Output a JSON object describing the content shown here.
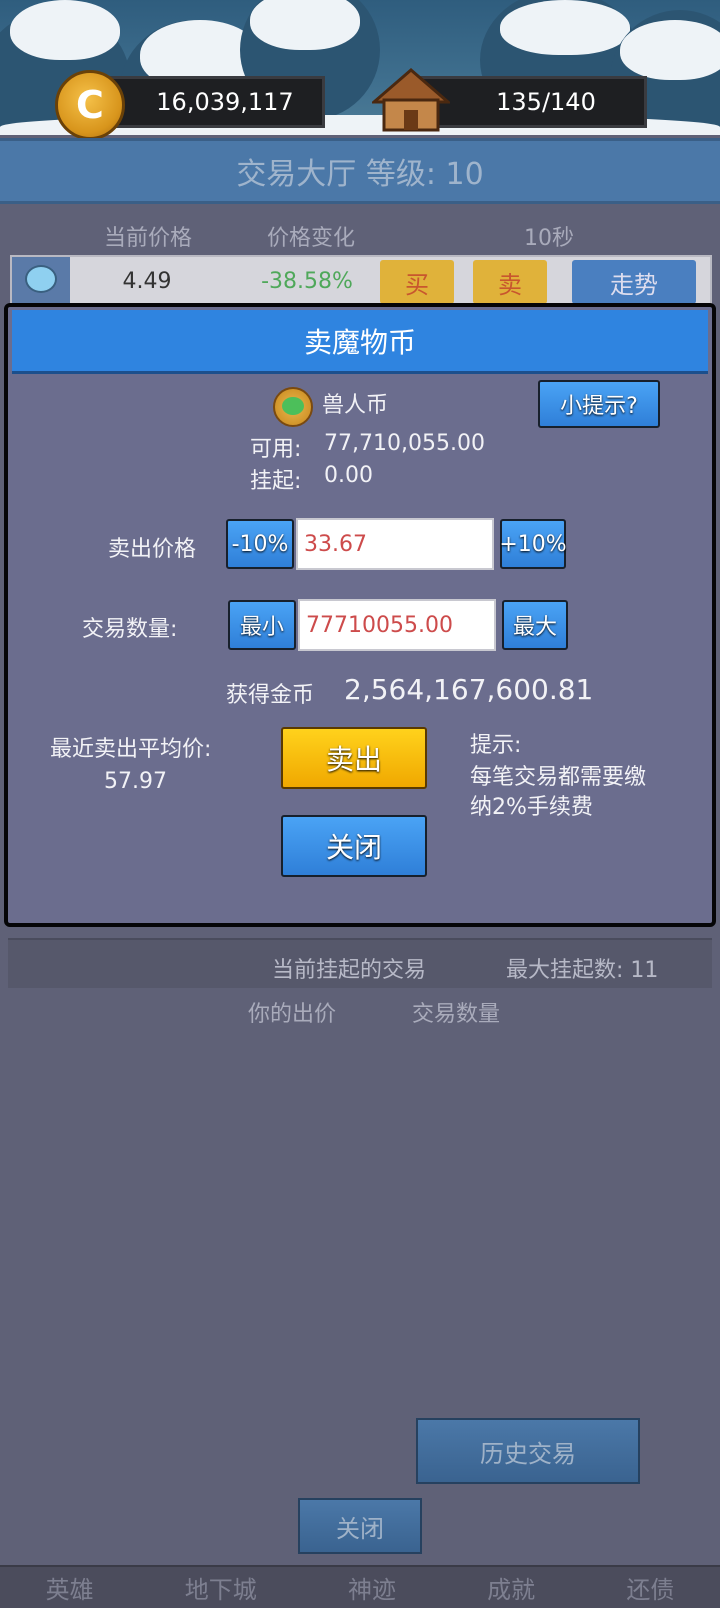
{
  "hud": {
    "gold": "16,039,117",
    "capacity": "135/140",
    "coin_icon_glyph": "C"
  },
  "hall": {
    "title": "交易大厅 等级: 10",
    "col_price": "当前价格",
    "col_change": "价格变化",
    "col_timer": "10秒",
    "row": {
      "price": "4.49",
      "change": "-38.58%",
      "buy_label": "买",
      "sell_label": "卖",
      "trend_label": "走势"
    }
  },
  "dialog": {
    "title": "卖魔物币",
    "currency_name": "兽人币",
    "tip_button": "小提示?",
    "available_label": "可用:",
    "available_value": "77,710,055.00",
    "pending_label": "挂起:",
    "pending_value": "0.00",
    "sell_price_label": "卖出价格",
    "minus_btn": "-10%",
    "price_value": "33.67",
    "plus_btn": "+10%",
    "quantity_label": "交易数量:",
    "min_btn": "最小",
    "quantity_value": "77710055.00",
    "max_btn": "最大",
    "receive_label": "获得金币",
    "receive_value": "2,564,167,600.81",
    "avg_label": "最近卖出平均价:",
    "avg_value": "57.97",
    "sell_btn": "卖出",
    "close_btn": "关闭",
    "hint_title": "提示:",
    "hint_line1": "每笔交易都需要缴",
    "hint_line2": "纳2%手续费"
  },
  "pending": {
    "title": "当前挂起的交易",
    "max_label": "最大挂起数: 11",
    "col_bid": "你的出价",
    "col_qty": "交易数量"
  },
  "bottom": {
    "history_btn": "历史交易",
    "close_btn": "关闭"
  },
  "nav": [
    "英雄",
    "地下城",
    "神迹",
    "成就",
    "还债"
  ],
  "colors": {
    "dialog_header": "#2f84e0",
    "sell_button": "#f7b500",
    "price_red": "#cd4b4b",
    "change_green": "#4fa85a"
  }
}
